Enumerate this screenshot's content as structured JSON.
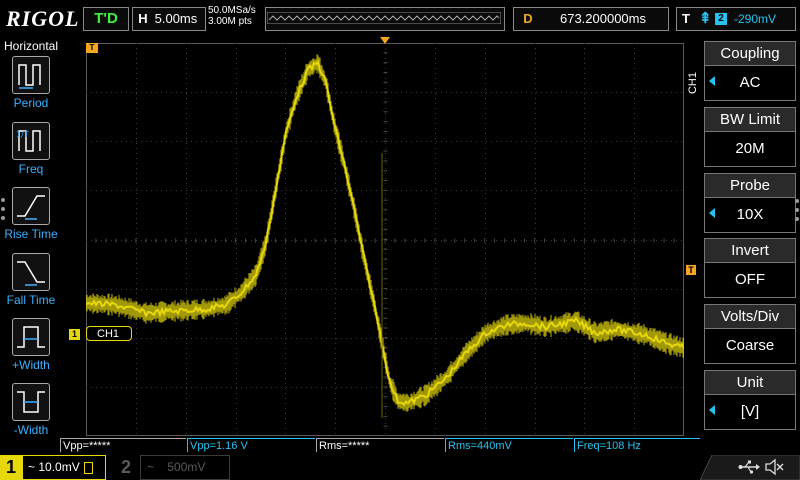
{
  "topbar": {
    "brand": "RIGOL",
    "trigger_status": "T'D",
    "horizontal": {
      "prefix": "H",
      "timebase": "5.00ms"
    },
    "sample_rate": "50.0MSa/s",
    "memory_points": "3.00M pts",
    "delay": {
      "prefix": "D",
      "value": "673.200000ms"
    },
    "trigger": {
      "prefix": "T",
      "edge": "⇞",
      "source": "2",
      "level": "-290mV"
    }
  },
  "left_menu": {
    "title": "Horizontal",
    "items": [
      {
        "label": "Period",
        "icon": "period-icon"
      },
      {
        "label": "Freq",
        "icon": "freq-icon"
      },
      {
        "label": "Rise Time",
        "icon": "rise-time-icon"
      },
      {
        "label": "Fall Time",
        "icon": "fall-time-icon"
      },
      {
        "label": "+Width",
        "icon": "plus-width-icon"
      },
      {
        "label": "-Width",
        "icon": "minus-width-icon"
      }
    ]
  },
  "screen": {
    "trigger_pos_marker": "T",
    "channel_marker": "1",
    "channel_tag": "CH1",
    "trace_color": "#e6d80a"
  },
  "right_menu": {
    "channel_label": "CH1",
    "items": [
      {
        "title": "Coupling",
        "value": "AC",
        "has_arrow": true
      },
      {
        "title": "BW Limit",
        "value": "20M",
        "has_arrow": false
      },
      {
        "title": "Probe",
        "value": "10X",
        "has_arrow": true
      },
      {
        "title": "Invert",
        "value": "OFF",
        "has_arrow": false
      },
      {
        "title": "Volts/Div",
        "value": "Coarse",
        "has_arrow": false
      },
      {
        "title": "Unit",
        "value": "[V]",
        "has_arrow": true
      }
    ]
  },
  "measurements": [
    {
      "text": "Vpp=*****",
      "color": "white"
    },
    {
      "text": "Vpp=1.16 V",
      "color": "cyan"
    },
    {
      "text": "Rms=*****",
      "color": "white"
    },
    {
      "text": "Rms=440mV",
      "color": "cyan"
    },
    {
      "text": "Freq=108 Hz",
      "color": "cyan"
    }
  ],
  "bottombar": {
    "ch1": {
      "number": "1",
      "scale": "~ 10.0mV"
    },
    "ch2": {
      "number": "2",
      "coupling": "~",
      "scale": "500mV"
    }
  },
  "colors": {
    "ch1": "#e6d80a",
    "accent_cyan": "#27c3f0",
    "marker_orange": "#f5a623",
    "trig_green": "#3df43d"
  }
}
